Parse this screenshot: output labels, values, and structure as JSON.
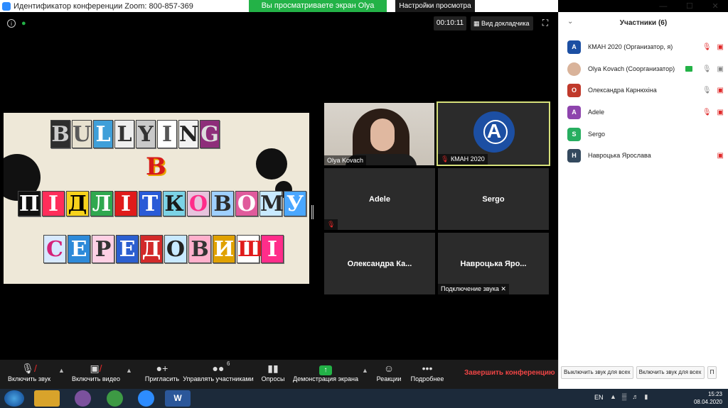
{
  "titlebar": {
    "title": "Идентификатор конференции Zoom: 800-857-369",
    "share_banner": "Вы просматриваете экран Olya Kovach",
    "view_options": "Настройки просмотра ⌄",
    "minimize": "—",
    "maximize": "☐",
    "close": "✕"
  },
  "meeting": {
    "timer": "00:10:11",
    "view_button": "Вид докладчика",
    "info_icon": "i",
    "lock_icon": "🔒"
  },
  "shared_slide": {
    "row1": [
      "B",
      "U",
      "L",
      "L",
      "Y",
      "I",
      "N",
      "G"
    ],
    "v": "В",
    "row2": [
      "П",
      "І",
      "Д",
      "Л",
      "І",
      "Т",
      "К",
      "О",
      "В",
      "О",
      "М",
      "У"
    ],
    "row3": [
      "С",
      "Е",
      "Р",
      "Е",
      "Д",
      "О",
      "В",
      "И",
      "Щ",
      "І"
    ]
  },
  "tiles": [
    {
      "name": "Olya Kovach"
    },
    {
      "name": "КМАН 2020"
    },
    {
      "name": "Adele"
    },
    {
      "name": "Sergo"
    },
    {
      "name": "Олександра  Ка..."
    },
    {
      "name": "Навроцька  Яро...",
      "status": "Подключение звука ✕"
    }
  ],
  "toolbar": {
    "audio": "Включить звук",
    "video": "Включить видео",
    "invite": "Пригласить",
    "manage": "Управлять участниками",
    "manage_count": "6",
    "polls": "Опросы",
    "share": "Демонстрация экрана",
    "reactions": "Реакции",
    "more": "Подробнее",
    "end": "Завершить конференцию"
  },
  "panel": {
    "title": "Участники (6)",
    "participants": [
      {
        "initial": "A",
        "name": "КМАН 2020 (Организатор, я)",
        "color": "#1c4fa3"
      },
      {
        "initial": "",
        "name": "Olya Kovach (Соорганизатор)",
        "color": "#d9b39a"
      },
      {
        "initial": "О",
        "name": "Олександра Карнюхіна",
        "color": "#c0392b"
      },
      {
        "initial": "A",
        "name": "Adele",
        "color": "#8e44ad"
      },
      {
        "initial": "S",
        "name": "Sergo",
        "color": "#27ae60"
      },
      {
        "initial": "Н",
        "name": "Навроцька Ярослава",
        "color": "#34495e"
      }
    ],
    "mute_all": "Выключить звук для всех",
    "unmute_all": "Включить звук для всех",
    "more": "П"
  },
  "taskbar": {
    "lang": "EN",
    "time": "15:23",
    "date": "08.04.2020",
    "word_label": "W"
  }
}
